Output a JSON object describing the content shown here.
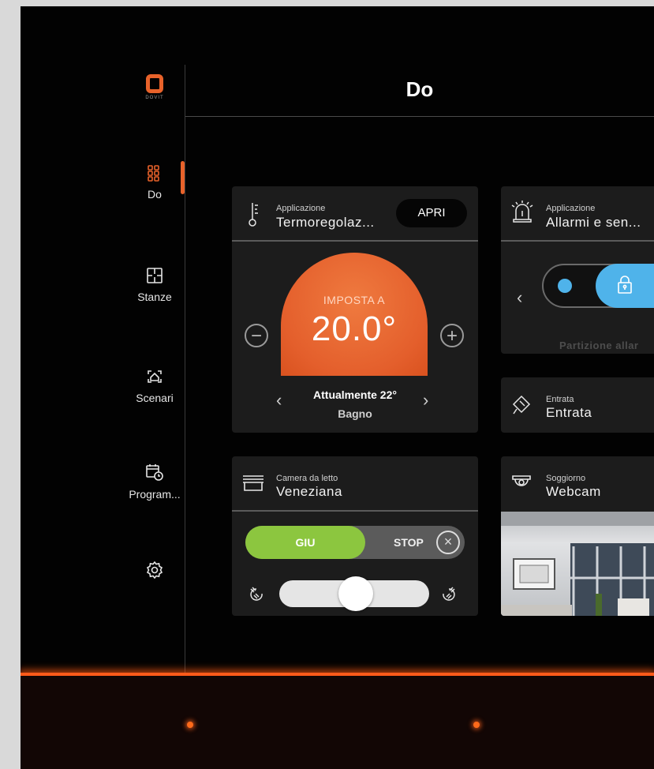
{
  "brand": {
    "logo_text": "DOVIT"
  },
  "header": {
    "title": "Do"
  },
  "sidebar": {
    "items": [
      {
        "label": "Do"
      },
      {
        "label": "Stanze"
      },
      {
        "label": "Scenari"
      },
      {
        "label": "Program..."
      }
    ]
  },
  "thermo_card": {
    "subtitle": "Applicazione",
    "title": "Termoregolaz...",
    "open_button": "APRI",
    "set_label": "IMPOSTA A",
    "set_value": "20.0°",
    "current": "Attualmente 22°",
    "room": "Bagno"
  },
  "alarm_card": {
    "subtitle": "Applicazione",
    "title": "Allarmi e sen...",
    "partition": "Partizione allar"
  },
  "entrata_card": {
    "subtitle": "Entrata",
    "title": "Entrata"
  },
  "blind_card": {
    "subtitle": "Camera da letto",
    "title": "Veneziana",
    "down_label": "GIU",
    "stop_label": "STOP"
  },
  "webcam_card": {
    "subtitle": "Soggiorno",
    "title": "Webcam"
  },
  "colors": {
    "accent": "#e8622a",
    "green": "#8cc63f",
    "blue": "#4fb3ea"
  }
}
